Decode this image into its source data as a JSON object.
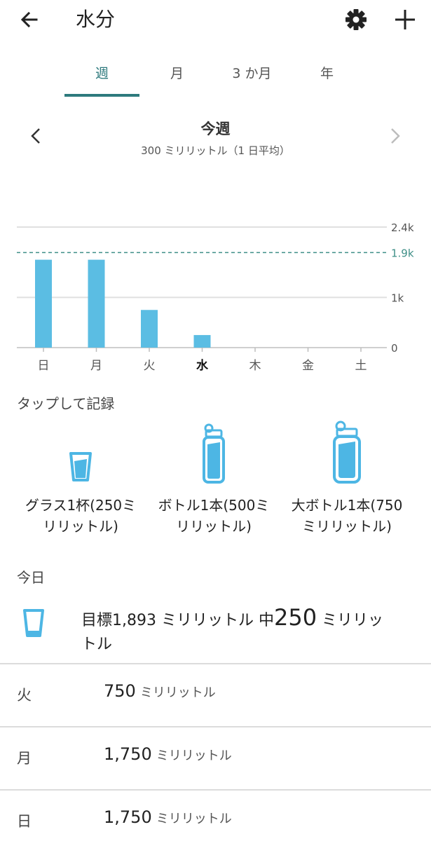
{
  "header": {
    "title": "水分",
    "back_icon": "arrow-left-icon",
    "settings_icon": "gear-icon",
    "add_icon": "plus-icon"
  },
  "tabs": [
    {
      "label": "週",
      "active": true
    },
    {
      "label": "月",
      "active": false
    },
    {
      "label": "3 か月",
      "active": false
    },
    {
      "label": "年",
      "active": false
    }
  ],
  "period": {
    "title": "今週",
    "subtitle": "300 ミリリットル（1 日平均）"
  },
  "chart_data": {
    "type": "bar",
    "categories": [
      "日",
      "月",
      "火",
      "水",
      "木",
      "金",
      "土"
    ],
    "values": [
      1750,
      1750,
      750,
      250,
      0,
      0,
      0
    ],
    "highlighted_category": "水",
    "y_ticks": [
      {
        "value": 2400,
        "label": "2.4k"
      },
      {
        "value": 1000,
        "label": "1k"
      },
      {
        "value": 0,
        "label": "0"
      }
    ],
    "goal": {
      "value": 1893,
      "label": "1.9k"
    },
    "ylim": [
      0,
      2400
    ],
    "bar_color": "#5bbde3",
    "goal_color": "#3f8f87"
  },
  "quick_add": {
    "label": "タップして記録",
    "items": [
      {
        "name": "グラス1杯",
        "sub": "(250ミリリットル)",
        "line1": "グラス1杯(250ミ",
        "line2": "リリットル)"
      },
      {
        "name": "ボトル1本",
        "sub": "(500ミリリットル)",
        "line1": "ボトル1本(500ミ",
        "line2": "リリットル)"
      },
      {
        "name": "大ボトル1本",
        "sub": "(750ミリリットル)",
        "line1": "大ボトル1本(750",
        "line2": "ミリリットル)"
      }
    ]
  },
  "today": {
    "label": "今日",
    "goal_prefix": "目標1,893 ミリリットル 中",
    "amount": "250",
    "unit_line1": "ミリリッ",
    "unit_line2": "トル"
  },
  "history": [
    {
      "day": "火",
      "value": "750",
      "unit": "ミリリットル"
    },
    {
      "day": "月",
      "value": "1,750",
      "unit": "ミリリットル"
    },
    {
      "day": "日",
      "value": "1,750",
      "unit": "ミリリットル"
    }
  ],
  "colors": {
    "accent": "#2e7a7d",
    "water": "#5bbde3"
  }
}
